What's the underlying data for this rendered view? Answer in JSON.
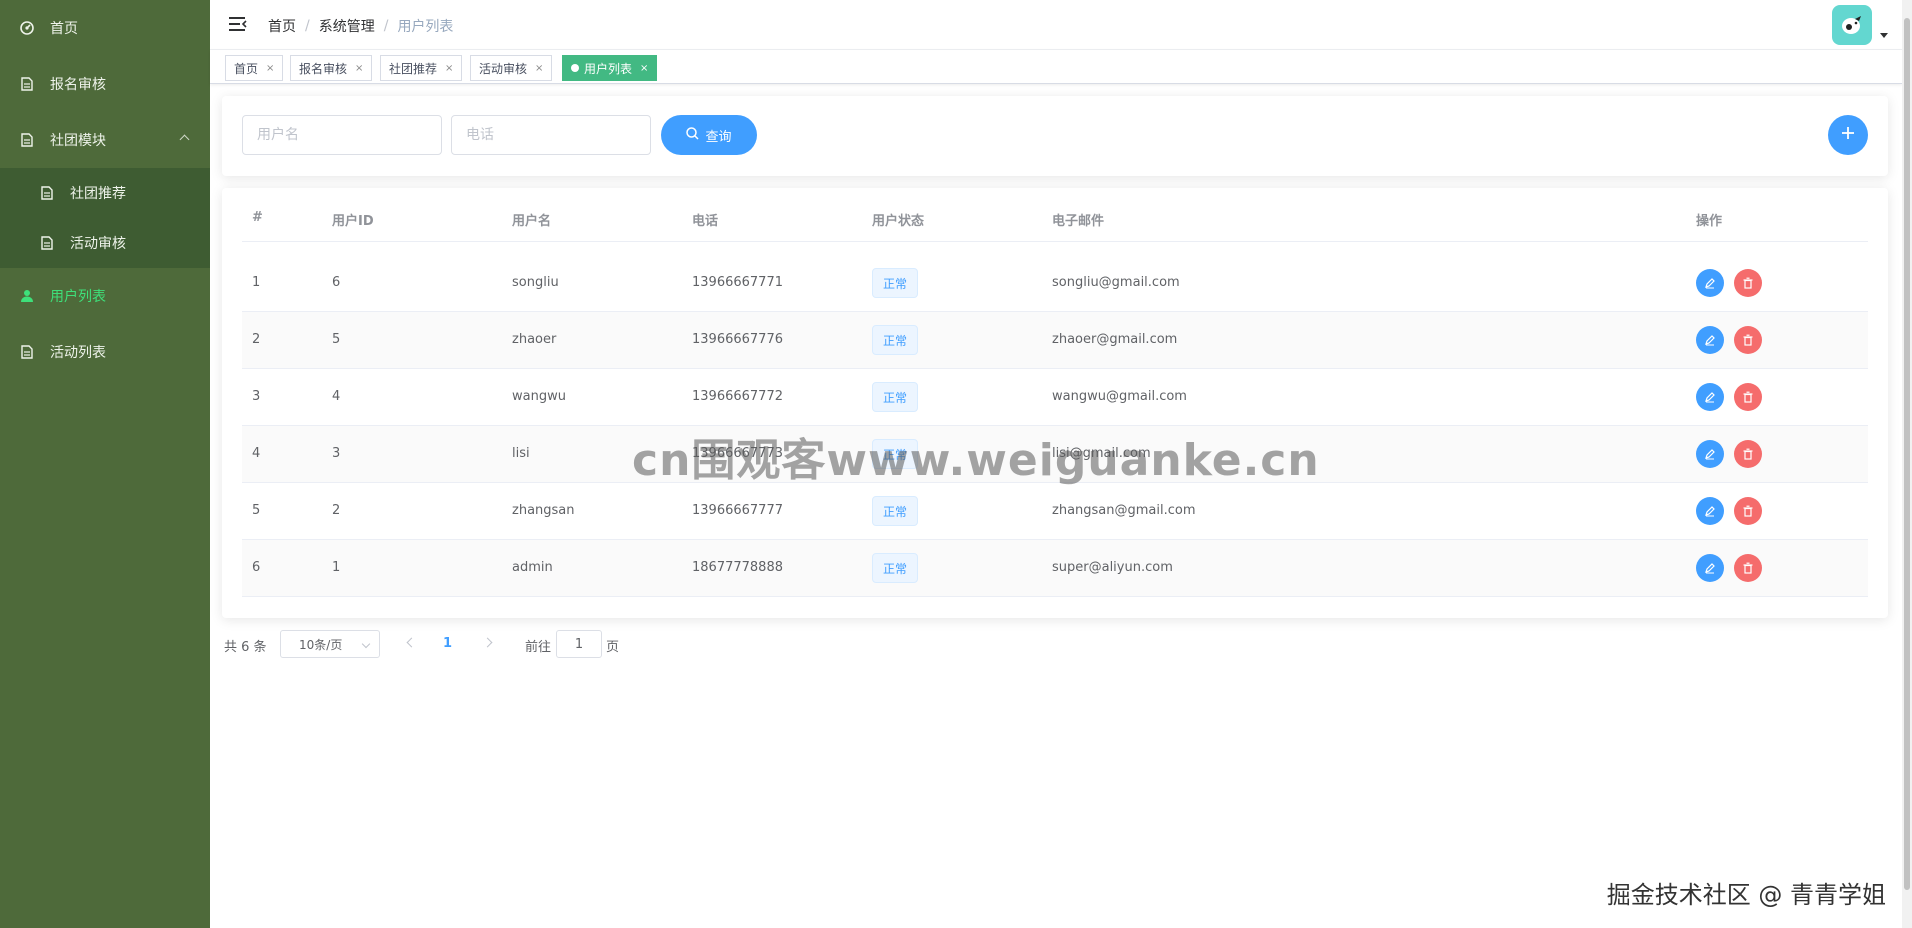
{
  "sidebar": {
    "items": [
      {
        "label": "首页",
        "icon": "dashboard-icon"
      },
      {
        "label": "报名审核",
        "icon": "document-icon"
      },
      {
        "label": "社团模块",
        "icon": "document-icon"
      },
      {
        "label": "用户列表",
        "icon": "user-icon",
        "active": true
      },
      {
        "label": "活动列表",
        "icon": "document-icon"
      }
    ],
    "submenu": [
      {
        "label": "社团推荐",
        "icon": "document-icon"
      },
      {
        "label": "活动审核",
        "icon": "document-icon"
      }
    ],
    "colors": {
      "background": "#4e6a3a",
      "submenu_bg": "#3e5c32",
      "active_text": "#3ee07a"
    }
  },
  "header": {
    "breadcrumb": [
      "首页",
      "系统管理",
      "用户列表"
    ],
    "breadcrumb_sep": "/"
  },
  "tags": [
    {
      "label": "首页"
    },
    {
      "label": "报名审核"
    },
    {
      "label": "社团推荐"
    },
    {
      "label": "活动审核"
    },
    {
      "label": "用户列表",
      "active": true
    }
  ],
  "tag_close": "×",
  "search": {
    "username_placeholder": "用户名",
    "phone_placeholder": "电话",
    "query_label": "查询"
  },
  "table": {
    "headers": [
      "#",
      "用户ID",
      "用户名",
      "电话",
      "用户状态",
      "电子邮件",
      "操作"
    ],
    "rows": [
      {
        "index": "1",
        "id": "6",
        "username": "songliu",
        "phone": "13966667771",
        "status": "正常",
        "email": "songliu@gmail.com"
      },
      {
        "index": "2",
        "id": "5",
        "username": "zhaoer",
        "phone": "13966667776",
        "status": "正常",
        "email": "zhaoer@gmail.com"
      },
      {
        "index": "3",
        "id": "4",
        "username": "wangwu",
        "phone": "13966667772",
        "status": "正常",
        "email": "wangwu@gmail.com"
      },
      {
        "index": "4",
        "id": "3",
        "username": "lisi",
        "phone": "13966667773",
        "status": "正常",
        "email": "lisi@gmail.com"
      },
      {
        "index": "5",
        "id": "2",
        "username": "zhangsan",
        "phone": "13966667777",
        "status": "正常",
        "email": "zhangsan@gmail.com"
      },
      {
        "index": "6",
        "id": "1",
        "username": "admin",
        "phone": "18677778888",
        "status": "正常",
        "email": "super@aliyun.com"
      }
    ]
  },
  "pagination": {
    "total": "共 6 条",
    "page_size": "10条/页",
    "current_page": "1",
    "goto_label": "前往",
    "goto_value": "1",
    "page_suffix": "页"
  },
  "watermarks": {
    "center": "cn围观客www.weiguanke.cn",
    "corner": "掘金技术社区 @ 青青学姐"
  },
  "colors": {
    "primary": "#409eff",
    "danger": "#f56c6c",
    "tag_active": "#42b983"
  }
}
